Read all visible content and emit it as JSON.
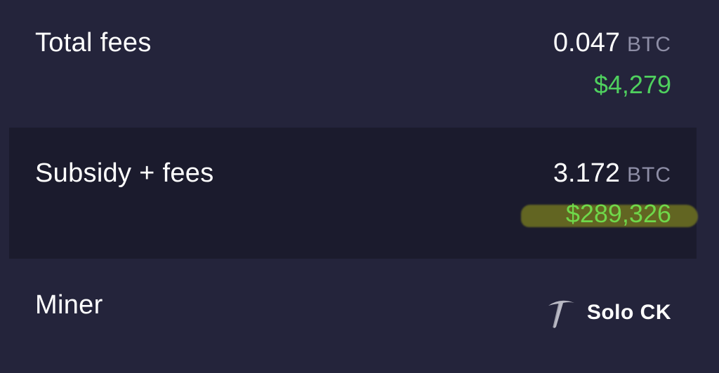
{
  "rows": [
    {
      "label": "Total fees",
      "btc_value": "0.047",
      "btc_unit": "BTC",
      "usd_value": "$4,279"
    },
    {
      "label": "Subsidy + fees",
      "btc_value": "3.172",
      "btc_unit": "BTC",
      "usd_value": "$289,326"
    }
  ],
  "miner": {
    "label": "Miner",
    "name": "Solo CK",
    "icon": "pickaxe-icon"
  },
  "colors": {
    "background": "#24243b",
    "highlight_row": "#1b1b2d",
    "usd_green": "#4fd05e",
    "unit_gray": "#8e8ea6",
    "marker_highlight": "#9ca21a"
  }
}
